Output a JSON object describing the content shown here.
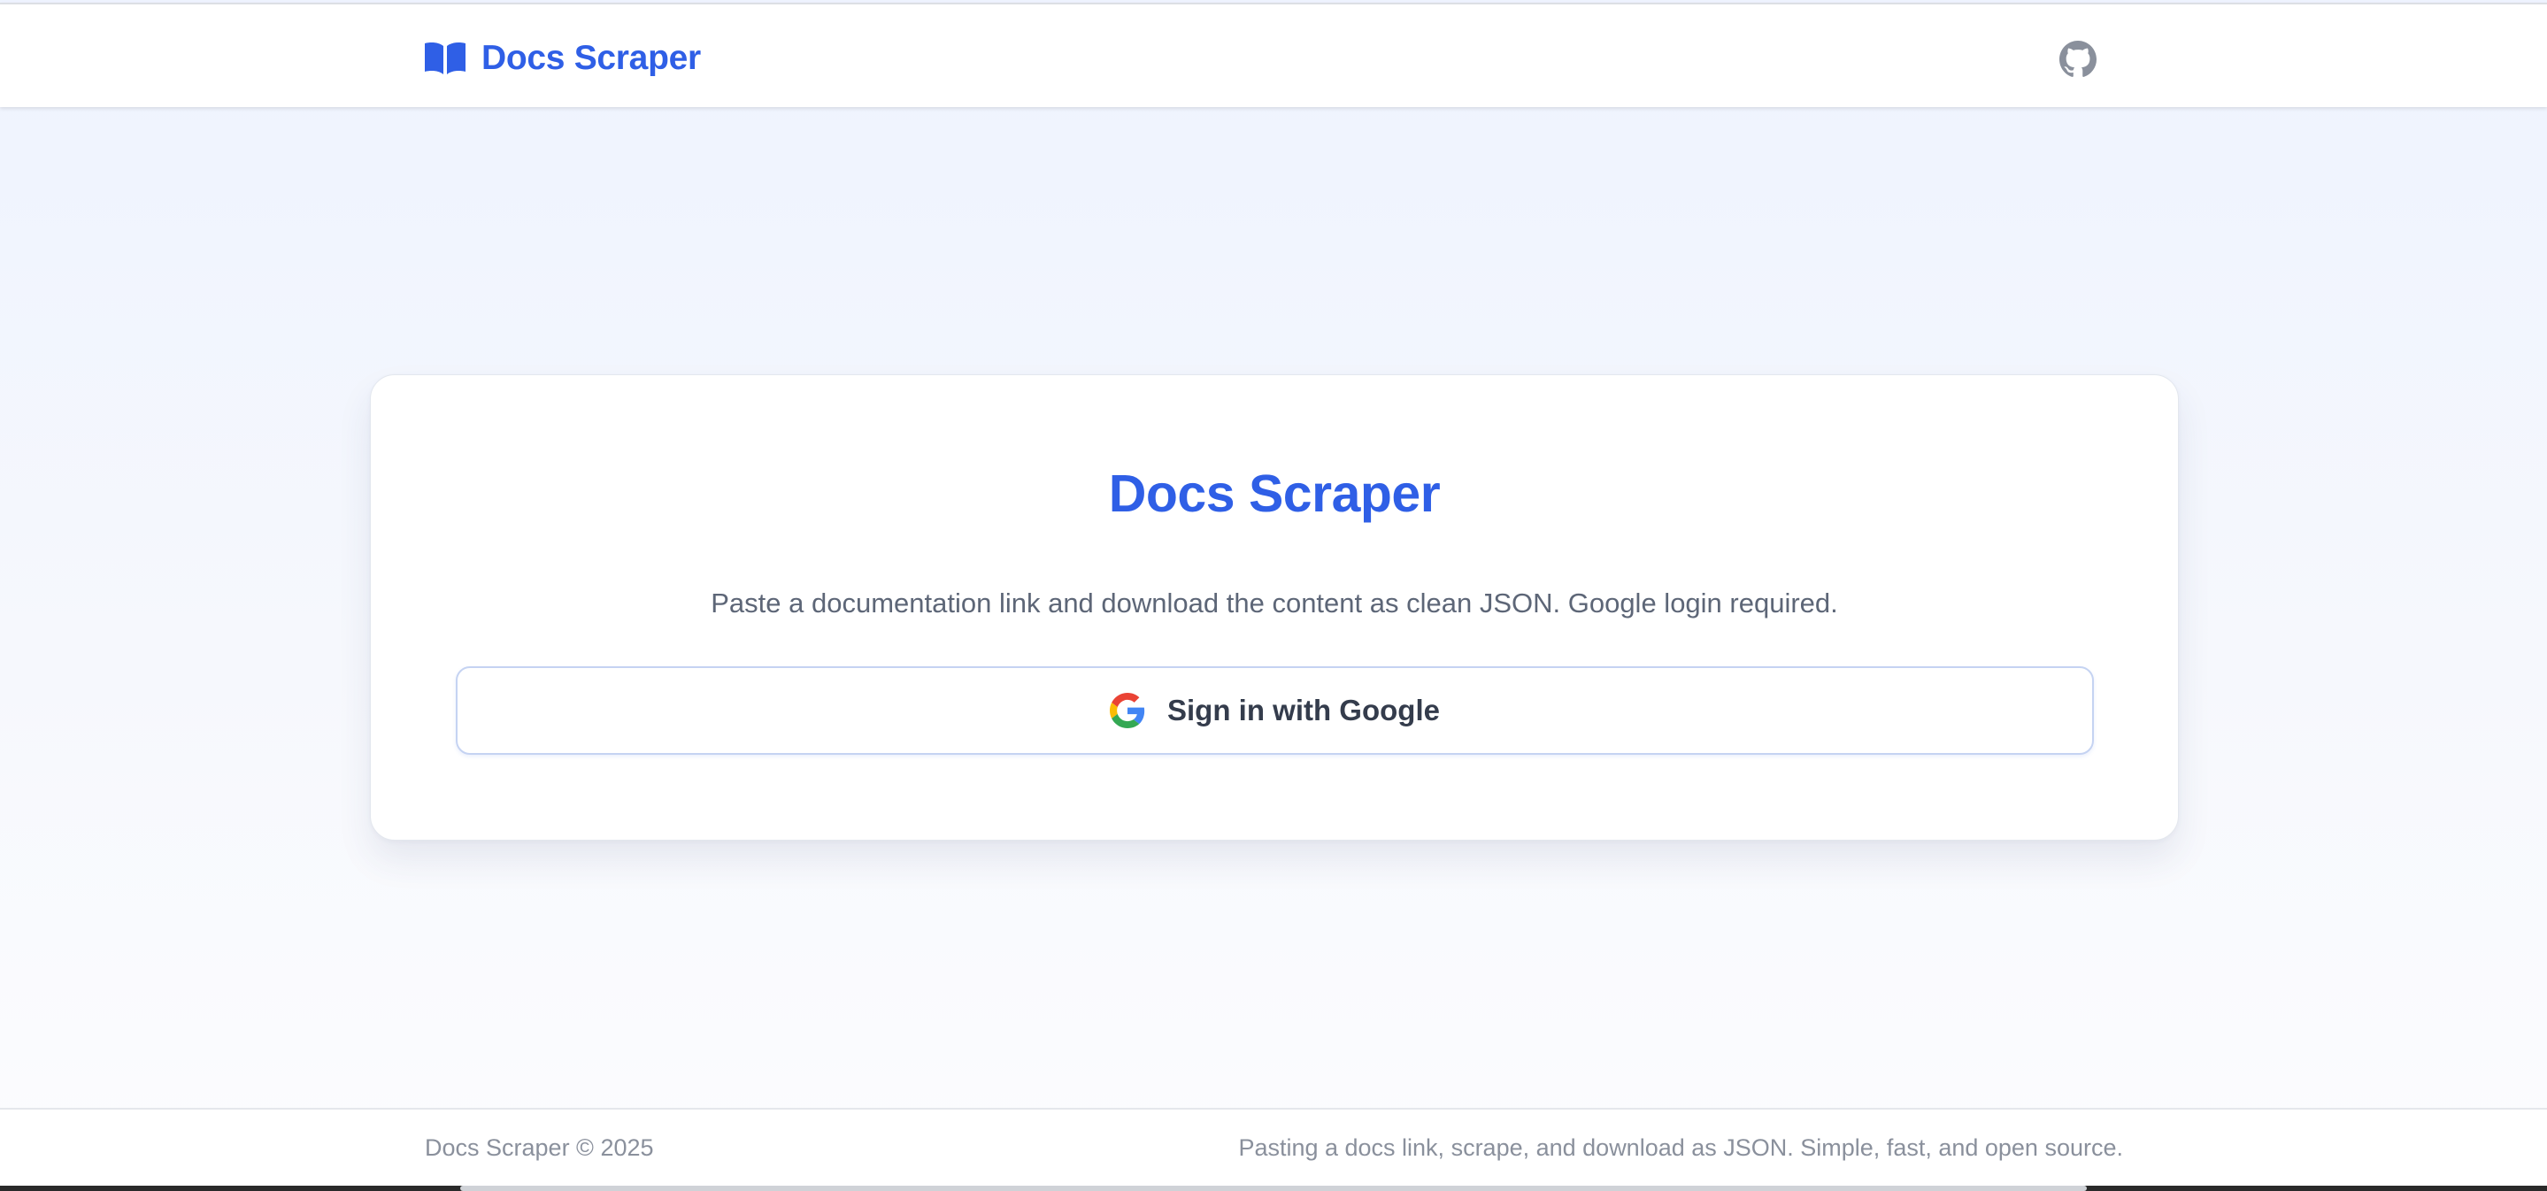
{
  "header": {
    "brand": "Docs Scraper",
    "brand_icon": "book-open-icon",
    "github_icon": "github-icon"
  },
  "card": {
    "title": "Docs Scraper",
    "description": "Paste a documentation link and download the content as clean JSON. Google login required.",
    "button_label": "Sign in with Google",
    "button_icon": "google-icon"
  },
  "footer": {
    "left": "Docs Scraper © 2025",
    "right": "Pasting a docs link, scrape, and download as JSON. Simple, fast, and open source."
  },
  "colors": {
    "accent": "#2f5fe6",
    "muted_text": "#5d6677",
    "footer_text": "#8a909c",
    "github_icon": "#8a909c"
  }
}
